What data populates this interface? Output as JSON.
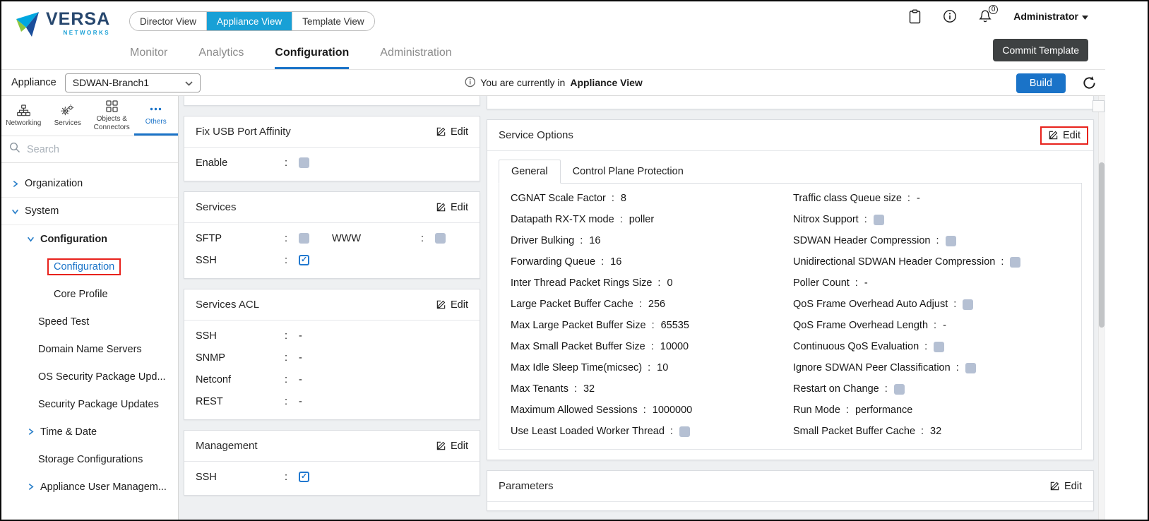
{
  "colors": {
    "accent_teal": "#18a0d6",
    "accent_blue": "#1a73c8",
    "commit_dark": "#3e4142",
    "highlight_red": "#e8221c",
    "checkbox_unchecked": "#b5c0d3",
    "checkbox_checked_border": "#2178cf"
  },
  "header": {
    "logo": {
      "brand": "VERSA",
      "sub": "NETWORKS"
    },
    "view_tabs": [
      {
        "label": "Director View",
        "active": false
      },
      {
        "label": "Appliance View",
        "active": true
      },
      {
        "label": "Template View",
        "active": false
      }
    ],
    "nav_tabs": [
      {
        "label": "Monitor",
        "active": false
      },
      {
        "label": "Analytics",
        "active": false
      },
      {
        "label": "Configuration",
        "active": true
      },
      {
        "label": "Administration",
        "active": false
      }
    ],
    "notification_badge": "0",
    "user_menu": "Administrator",
    "commit_button": "Commit Template"
  },
  "appliance_bar": {
    "label": "Appliance",
    "appliance_select": "SDWAN-Branch1",
    "notice_text": "You are currently in",
    "notice_emphasis": "Appliance View",
    "build_button": "Build"
  },
  "sidebar": {
    "tabs": [
      {
        "label": "Networking",
        "icon": "sitemap-icon",
        "active": false
      },
      {
        "label": "Services",
        "icon": "gears-icon",
        "active": false
      },
      {
        "label": "Objects & Connectors",
        "icon": "grid-icon",
        "active": false
      },
      {
        "label": "Others",
        "icon": "ellipsis-icon",
        "active": true
      }
    ],
    "search_placeholder": "Search",
    "tree": [
      {
        "label": "Organization",
        "level": 0,
        "chevron": "right",
        "divider": true
      },
      {
        "label": "System",
        "level": 0,
        "chevron": "down",
        "divider": true
      },
      {
        "label": "Configuration",
        "level": 1,
        "chevron": "down",
        "bold": true
      },
      {
        "label": "Configuration",
        "level": 2,
        "selected": true
      },
      {
        "label": "Core Profile",
        "level": 2
      },
      {
        "label": "Speed Test",
        "level": 1
      },
      {
        "label": "Domain Name Servers",
        "level": 1
      },
      {
        "label": "OS Security Package Upd...",
        "level": 1
      },
      {
        "label": "Security Package Updates",
        "level": 1
      },
      {
        "label": "Time & Date",
        "level": 1,
        "chevron": "right"
      },
      {
        "label": "Storage Configurations",
        "level": 1
      },
      {
        "label": "Appliance User Managem...",
        "level": 1,
        "chevron": "right"
      }
    ]
  },
  "cards_left": [
    {
      "title": "Fix USB Port Affinity",
      "edit_label": "Edit",
      "rows": [
        [
          {
            "label": "Enable",
            "type": "checkbox",
            "checked": false
          }
        ]
      ]
    },
    {
      "title": "Services",
      "edit_label": "Edit",
      "rows": [
        [
          {
            "label": "SFTP",
            "type": "checkbox",
            "checked": false
          },
          {
            "label": "WWW",
            "type": "checkbox",
            "checked": false
          }
        ],
        [
          {
            "label": "SSH",
            "type": "checkbox",
            "checked": true
          }
        ]
      ]
    },
    {
      "title": "Services ACL",
      "edit_label": "Edit",
      "rows": [
        [
          {
            "label": "SSH",
            "type": "text",
            "value": "-"
          }
        ],
        [
          {
            "label": "SNMP",
            "type": "text",
            "value": "-"
          }
        ],
        [
          {
            "label": "Netconf",
            "type": "text",
            "value": "-"
          }
        ],
        [
          {
            "label": "REST",
            "type": "text",
            "value": "-"
          }
        ]
      ]
    },
    {
      "title": "Management",
      "edit_label": "Edit",
      "rows": [
        [
          {
            "label": "SSH",
            "type": "checkbox",
            "checked": true
          }
        ]
      ]
    }
  ],
  "service_options": {
    "title": "Service Options",
    "edit_label": "Edit",
    "edit_highlighted": true,
    "tabs": [
      {
        "label": "General",
        "active": true
      },
      {
        "label": "Control Plane Protection",
        "active": false
      }
    ],
    "fields_left": [
      {
        "label": "CGNAT Scale Factor",
        "type": "text",
        "value": "8"
      },
      {
        "label": "Datapath RX-TX mode",
        "type": "text",
        "value": "poller"
      },
      {
        "label": "Driver Bulking",
        "type": "text",
        "value": "16"
      },
      {
        "label": "Forwarding Queue",
        "type": "text",
        "value": "16"
      },
      {
        "label": "Inter Thread Packet Rings Size",
        "type": "text",
        "value": "0"
      },
      {
        "label": "Large Packet Buffer Cache",
        "type": "text",
        "value": "256"
      },
      {
        "label": "Max Large Packet Buffer Size",
        "type": "text",
        "value": "65535"
      },
      {
        "label": "Max Small Packet Buffer Size",
        "type": "text",
        "value": "10000"
      },
      {
        "label": "Max Idle Sleep Time(micsec)",
        "type": "text",
        "value": "10"
      },
      {
        "label": "Max Tenants",
        "type": "text",
        "value": "32"
      },
      {
        "label": "Maximum Allowed Sessions",
        "type": "text",
        "value": "1000000"
      },
      {
        "label": "Use Least Loaded Worker Thread",
        "type": "checkbox",
        "checked": false
      }
    ],
    "fields_right": [
      {
        "label": "Traffic class Queue size",
        "type": "text",
        "value": "-"
      },
      {
        "label": "Nitrox Support",
        "type": "checkbox",
        "checked": false
      },
      {
        "label": "SDWAN Header Compression",
        "type": "checkbox",
        "checked": false
      },
      {
        "label": "Unidirectional SDWAN Header Compression",
        "type": "checkbox",
        "checked": false
      },
      {
        "label": "Poller Count",
        "type": "text",
        "value": "-"
      },
      {
        "label": "QoS Frame Overhead Auto Adjust",
        "type": "checkbox",
        "checked": false
      },
      {
        "label": "QoS Frame Overhead Length",
        "type": "text",
        "value": "-"
      },
      {
        "label": "Continuous QoS Evaluation",
        "type": "checkbox",
        "checked": false
      },
      {
        "label": "Ignore SDWAN Peer Classification",
        "type": "checkbox",
        "checked": false
      },
      {
        "label": "Restart on Change",
        "type": "checkbox",
        "checked": false
      },
      {
        "label": "Run Mode",
        "type": "text",
        "value": "performance"
      },
      {
        "label": "Small Packet Buffer Cache",
        "type": "text",
        "value": "32"
      }
    ]
  },
  "parameters_card": {
    "title": "Parameters",
    "edit_label": "Edit"
  }
}
